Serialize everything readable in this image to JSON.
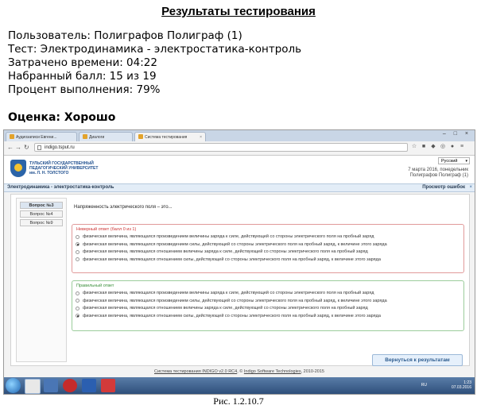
{
  "results": {
    "title": "Результаты тестирования",
    "user": "Пользователь: Полиграфов Полиграф (1)",
    "test": "Тест: Электродинамика - электростатика-контроль",
    "time": "Затрачено времени: 04:22",
    "score": "Набранный балл: 15 из 19",
    "percent": "Процент выполнения: 79%",
    "grade": "Оценка: Хорошо"
  },
  "browser": {
    "tabs": [
      {
        "label": "Аудиозаписи Евгени..."
      },
      {
        "label": "Диалоги"
      },
      {
        "label": "Система тестирования"
      }
    ],
    "url": "indigo.tsput.ru",
    "window_controls": "– □ ×"
  },
  "site": {
    "university": [
      "ТУЛЬСКИЙ ГОСУДАРСТВЕННЫЙ",
      "ПЕДАГОГИЧЕСКИЙ УНИВЕРСИТЕТ",
      "им. Л. Н. ТОЛСТОГО"
    ],
    "language": "Русский",
    "date_line": "7 марта 2016, понедельник",
    "user_line": "Полиграфов Полиграф (1)",
    "test_title": "Электродинамика - электростатика-контроль",
    "review_label": "Просмотр ошибок",
    "close_symbol": "×"
  },
  "questions_nav": [
    "Вопрос №3",
    "Вопрос №4",
    "Вопрос №9"
  ],
  "question": {
    "text": "Напряженность электрического поля – это...",
    "wrong_title": "Неверный ответ (балл 0 из 1)",
    "wrong_options": [
      "физическая величина, являющаяся произведением величины заряда к силе, действующей со стороны электрического поля на пробный заряд",
      "физическая величина, являющаяся произведением силы, действующей со стороны электрического поля на пробный заряд, к величине этого заряда",
      "физическая величина, являющаяся отношением величины заряда к силе, действующей со стороны электрического поля на пробный заряд",
      "физическая величина, являющаяся отношением силы, действующей со стороны электрического поля на пробный заряд, к величине этого заряда"
    ],
    "right_title": "Правильный ответ",
    "right_options": [
      "физическая величина, являющаяся произведением величины заряда к силе, действующей со стороны электрического поля на пробный заряд",
      "физическая величина, являющаяся произведением силы, действующей со стороны электрического поля на пробный заряд, к величине этого заряда",
      "физическая величина, являющаяся отношением величины заряда к силе, действующей со стороны электрического поля на пробный заряд",
      "физическая величина, являющаяся отношением силы, действующей со стороны электрического поля на пробный заряд, к величине этого заряда"
    ]
  },
  "back_button": "Вернуться к результатам",
  "footer": {
    "system_link": "Система тестирования INDIGO v2.0 RC4",
    "sep1": ", © ",
    "company_link": "Indigo Software Technologies",
    "years": ", 2010-2015"
  },
  "taskbar": {
    "lang": "RU",
    "time": "1:23",
    "date": "07.03.2016"
  },
  "caption": "Рис. 1.2.10.7"
}
